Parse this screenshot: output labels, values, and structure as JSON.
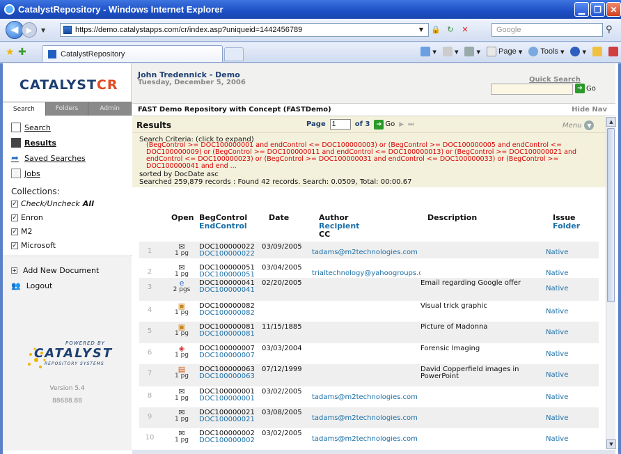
{
  "browser": {
    "title": "CatalystRepository - Windows Internet Explorer",
    "url": "https://demo.catalystapps.com/cr/index.asp?uniqueid=1442456789",
    "search_placeholder": "Google",
    "tab_label": "CatalystRepository",
    "commands": {
      "page": "Page",
      "tools": "Tools"
    }
  },
  "sidebar": {
    "logo_main": "CATALYST",
    "logo_accent": "CR",
    "tabs": [
      "Search",
      "Folders",
      "Admin"
    ],
    "nav": [
      {
        "label": "Search"
      },
      {
        "label": "Results"
      },
      {
        "label": "Saved Searches"
      },
      {
        "label": "Jobs"
      }
    ],
    "collections_title": "Collections:",
    "collections": [
      {
        "label": "Check/Uncheck",
        "bold": "All"
      },
      {
        "label": "Enron"
      },
      {
        "label": "M2"
      },
      {
        "label": "Microsoft"
      }
    ],
    "actions": [
      {
        "label": "Add New Document"
      },
      {
        "label": "Logout"
      }
    ],
    "powered": {
      "small": "POWERED BY",
      "name": "CATALYST",
      "sub": "REPOSITORY SYSTEMS",
      "version": "Version 5.4",
      "number": "88688.88"
    }
  },
  "header": {
    "user": "John Tredennick - Demo",
    "date": "Tuesday, December 5, 2006",
    "quick_search_label": "Quick Search",
    "go_label": "Go",
    "repository": "FAST Demo Repository with Concept (FASTDemo)",
    "hide_nav": "Hide Nav"
  },
  "results": {
    "title": "Results",
    "page_label": "Page",
    "page_value": "1",
    "of_label": "of 3",
    "go_label": "Go",
    "menu_label": "Menu",
    "criteria_label": "Search Criteria: (click to expand)",
    "criteria": "(BegControl >= DOC100000001 and endControl <= DOC100000003) or (BegControl >= DOC100000005 and endControl <= DOC100000009) or (BegControl >= DOC100000011 and endControl <= DOC100000013) or (BegControl >= DOC100000021 and endControl <= DOC100000023) or (BegControl >= DOC100000031 and endControl <= DOC100000033) or (BegControl >= DOC100000041 and end ...",
    "sorted": "sorted by DocDate asc",
    "stats": "Searched 259,879 records : Found 42 records. Search: 0.0509, Total: 00:00.67"
  },
  "table": {
    "headers": {
      "open": "Open",
      "beg": "BegControl",
      "end": "EndControl",
      "date": "Date",
      "author": "Author",
      "recipient": "Recipient",
      "cc": "CC",
      "description": "Description",
      "issue": "Issue",
      "folder": "Folder"
    },
    "rows": [
      {
        "n": "1",
        "icon": "email-icon",
        "pages": "1 pg",
        "beg": "DOC100000022",
        "end": "DOC100000022",
        "date": "03/09/2005",
        "author": "tadams@m2technologies.com",
        "desc": "",
        "folder": "Native"
      },
      {
        "n": "2",
        "icon": "email-icon",
        "pages": "1 pg",
        "beg": "DOC100000051",
        "end": "DOC100000051",
        "date": "03/04/2005",
        "author": "trialtechnology@yahoogroups.c",
        "desc": "",
        "folder": "Native"
      },
      {
        "n": "3",
        "icon": "ie-page-icon",
        "pages": "2 pgs",
        "beg": "DOC100000041",
        "end": "DOC100000041",
        "date": "02/20/2005",
        "author": "",
        "desc": "Email regarding Google offer",
        "folder": "Native"
      },
      {
        "n": "4",
        "icon": "image-file-icon",
        "pages": "1 pg",
        "beg": "DOC100000082",
        "end": "DOC100000082",
        "date": "",
        "author": "",
        "desc": "Visual trick graphic",
        "folder": "Native"
      },
      {
        "n": "5",
        "icon": "image-file-icon",
        "pages": "1 pg",
        "beg": "DOC100000081",
        "end": "DOC100000081",
        "date": "11/15/1885",
        "author": "",
        "desc": "Picture of Madonna",
        "folder": "Native"
      },
      {
        "n": "6",
        "icon": "imaging-icon",
        "pages": "1 pg",
        "beg": "DOC100000007",
        "end": "DOC100000007",
        "date": "03/03/2004",
        "author": "",
        "desc": "Forensic Imaging",
        "folder": "Native"
      },
      {
        "n": "7",
        "icon": "powerpoint-icon",
        "pages": "1 pg",
        "beg": "DOC100000063",
        "end": "DOC100000063",
        "date": "07/12/1999",
        "author": "",
        "desc": "David Copperfield images in PowerPoint",
        "folder": "Native"
      },
      {
        "n": "8",
        "icon": "email-icon",
        "pages": "1 pg",
        "beg": "DOC100000001",
        "end": "DOC100000001",
        "date": "03/02/2005",
        "author": "tadams@m2technologies.com",
        "desc": "",
        "folder": "Native"
      },
      {
        "n": "9",
        "icon": "email-icon",
        "pages": "1 pg",
        "beg": "DOC100000021",
        "end": "DOC100000021",
        "date": "03/08/2005",
        "author": "tadams@m2technologies.com",
        "desc": "",
        "folder": "Native"
      },
      {
        "n": "10",
        "icon": "email-icon",
        "pages": "1 pg",
        "beg": "DOC100000002",
        "end": "DOC100000002",
        "date": "03/02/2005",
        "author": "tadams@m2technologies.com",
        "desc": "",
        "folder": "Native"
      }
    ]
  }
}
